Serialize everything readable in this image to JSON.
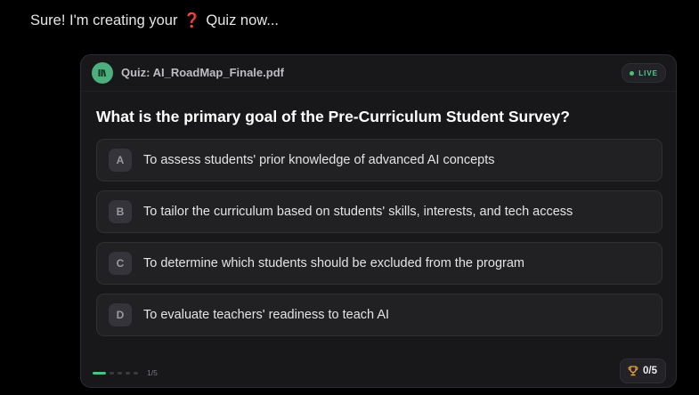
{
  "message": {
    "prefix": "Sure! I'm creating your",
    "icon": "question-mark-icon",
    "icon_glyph": "❓",
    "suffix": "Quiz now..."
  },
  "quiz": {
    "title": "Quiz: AI_RoadMap_Finale.pdf",
    "file_icon": "document-icon",
    "status_badge": "LIVE",
    "question": "What is the primary goal of the Pre-Curriculum Student Survey?",
    "options": [
      {
        "letter": "A",
        "text": "To assess students' prior knowledge of advanced AI concepts"
      },
      {
        "letter": "B",
        "text": "To tailor the curriculum based on students' skills, interests, and tech access"
      },
      {
        "letter": "C",
        "text": "To determine which students should be excluded from the program"
      },
      {
        "letter": "D",
        "text": "To evaluate teachers' readiness to teach AI"
      }
    ],
    "progress": {
      "current": 1,
      "total": 5,
      "label": "1/5"
    },
    "score": {
      "icon": "trophy-icon",
      "label": "0/5"
    }
  },
  "colors": {
    "background": "#000000",
    "card": "#18181b",
    "option_bg": "#212124",
    "accent_green": "#4fbf82",
    "trophy": "#e8a23a",
    "question_icon": "#d4462e"
  }
}
